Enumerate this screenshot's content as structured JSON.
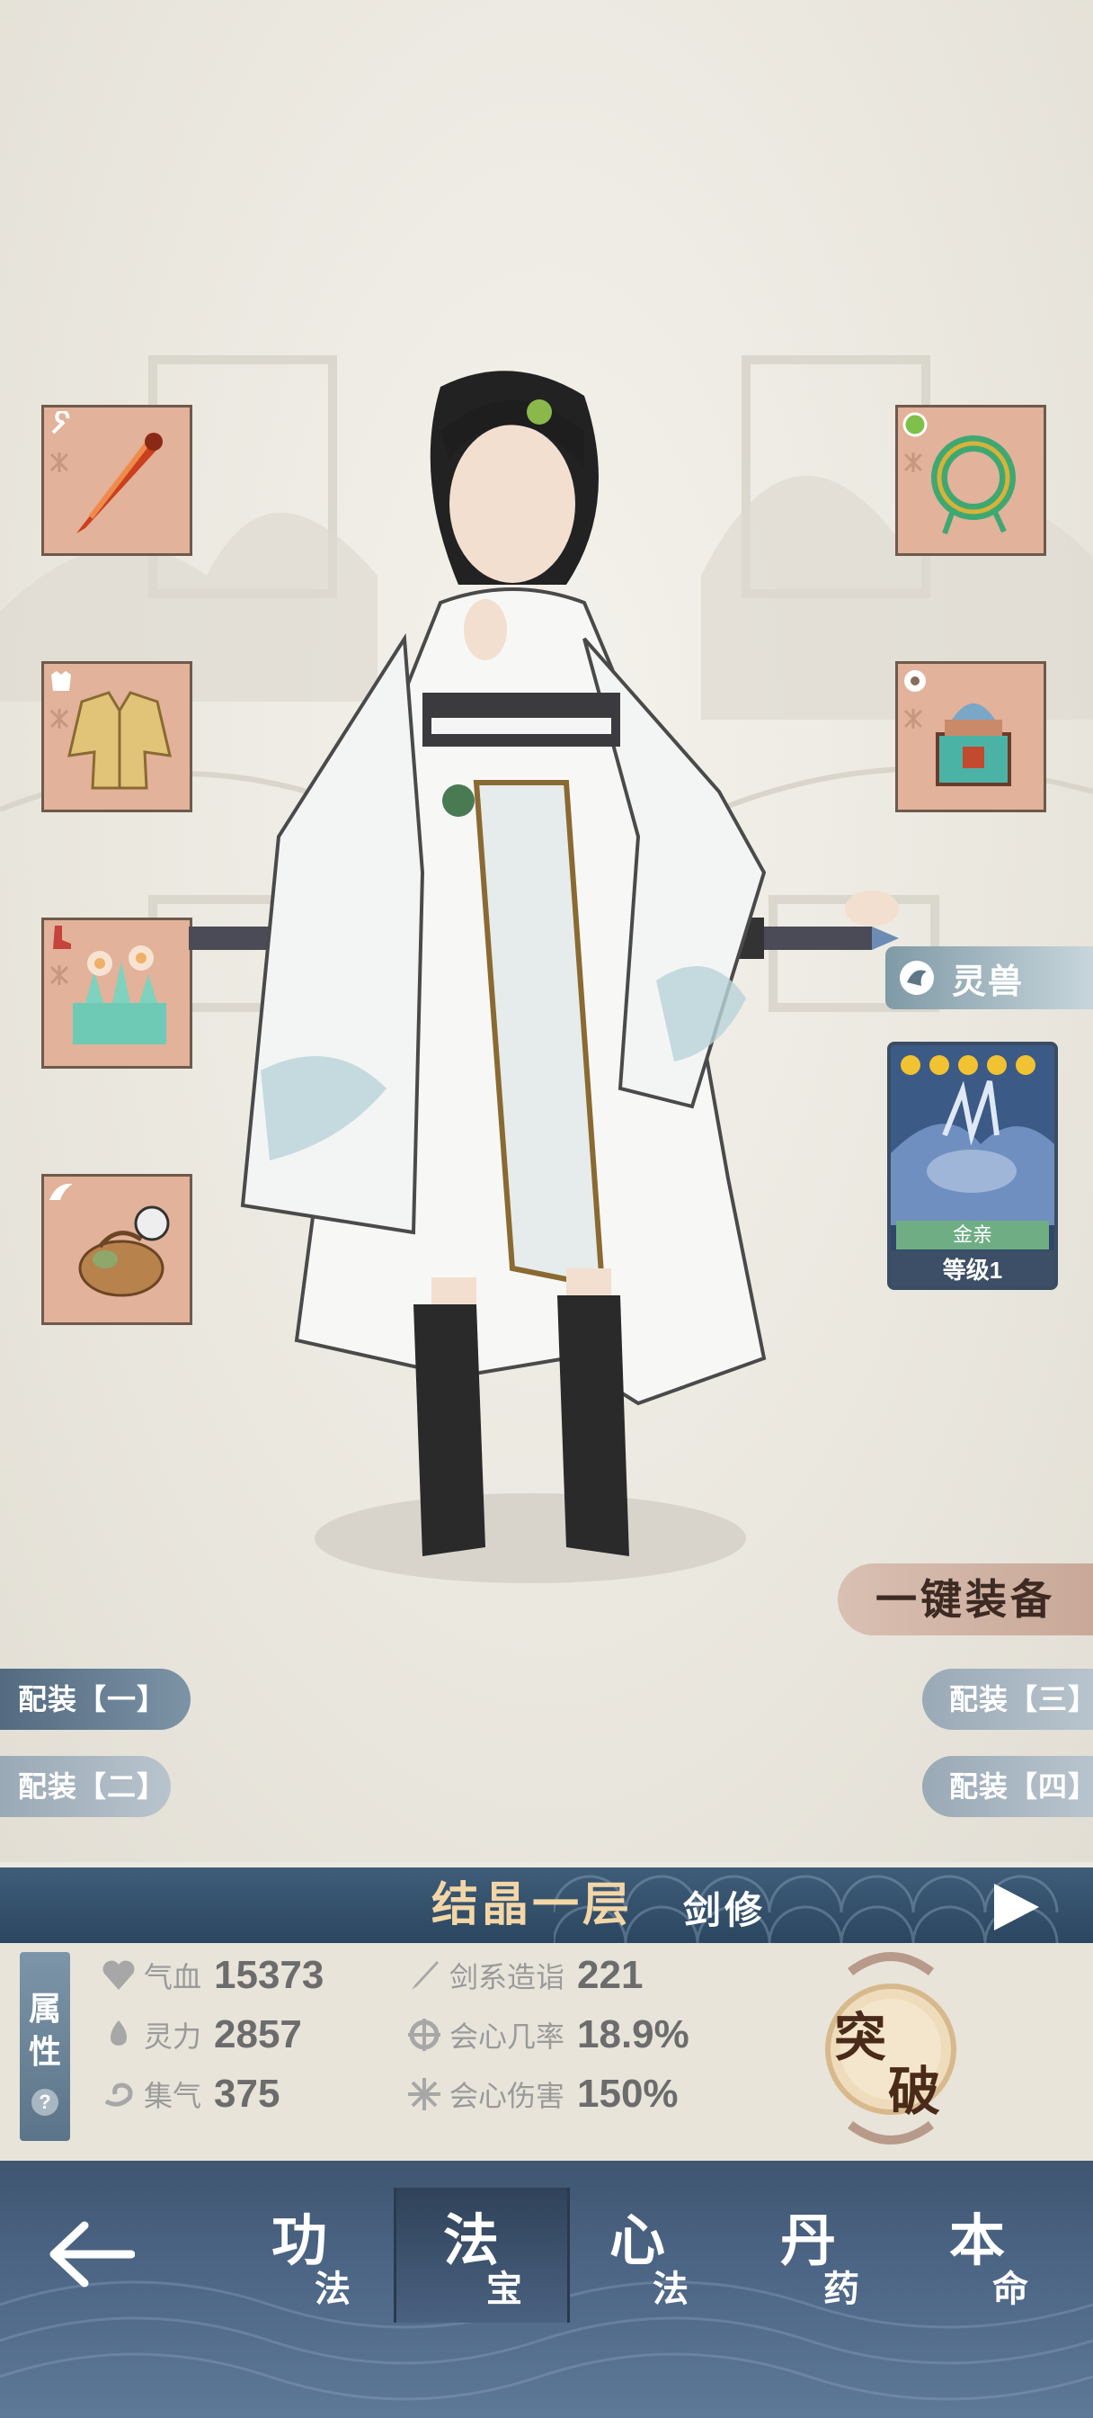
{
  "colors": {
    "slot_bg": "#e2b29a",
    "slot_border": "#6e5a4c",
    "realm_gold": "#f3d6a7",
    "nav_bg": "#4c6585",
    "loadout_active": "#536a80",
    "loadout_inactive": "#9aa9b6"
  },
  "equipment": {
    "left_slots": [
      {
        "icon": "sword-icon",
        "type_icon": "wrench-icon",
        "rune_icon": "rune-icon"
      },
      {
        "icon": "robe-icon",
        "type_icon": "armor-icon",
        "rune_icon": "rune-icon"
      },
      {
        "icon": "lotus-icon",
        "type_icon": "boots-icon",
        "rune_icon": "rune-icon"
      },
      {
        "icon": "pouch-icon",
        "type_icon": "wing-icon"
      }
    ],
    "right_slots": [
      {
        "icon": "jade-ring-icon",
        "type_icon": "ring-type-icon",
        "rune_icon": "rune-icon"
      },
      {
        "icon": "cauldron-icon",
        "type_icon": "pendant-type-icon",
        "rune_icon": "rune-icon"
      }
    ]
  },
  "pet": {
    "tag_label": "灵兽",
    "bond": "金亲",
    "level": "等级1",
    "paws": 5
  },
  "actions": {
    "one_key_equip": "一键装备",
    "loadouts": [
      "配装【一】",
      "配装【二】",
      "配装【三】",
      "配装【四】"
    ],
    "active_loadout": 0
  },
  "realm": {
    "name": "结晶一层",
    "class": "剑修"
  },
  "stats_panel": {
    "tab_label_1": "属",
    "tab_label_2": "性",
    "help": "?",
    "left": [
      {
        "icon": "heart-icon",
        "label": "气血",
        "value": "15373"
      },
      {
        "icon": "flame-icon",
        "label": "灵力",
        "value": "2857"
      },
      {
        "icon": "swirl-icon",
        "label": "集气",
        "value": "375"
      }
    ],
    "right": [
      {
        "icon": "sword-icon",
        "label": "剑系造诣",
        "value": "221"
      },
      {
        "icon": "crit-icon",
        "label": "会心几率",
        "value": "18.9%"
      },
      {
        "icon": "spark-icon",
        "label": "会心伤害",
        "value": "150%"
      }
    ],
    "breakthrough_1": "突",
    "breakthrough_2": "破"
  },
  "nav": {
    "tabs": [
      {
        "big": "功",
        "small": "法"
      },
      {
        "big": "法",
        "small": "宝"
      },
      {
        "big": "心",
        "small": "法"
      },
      {
        "big": "丹",
        "small": "药"
      },
      {
        "big": "本",
        "small": "命"
      }
    ],
    "active_tab": 1
  }
}
